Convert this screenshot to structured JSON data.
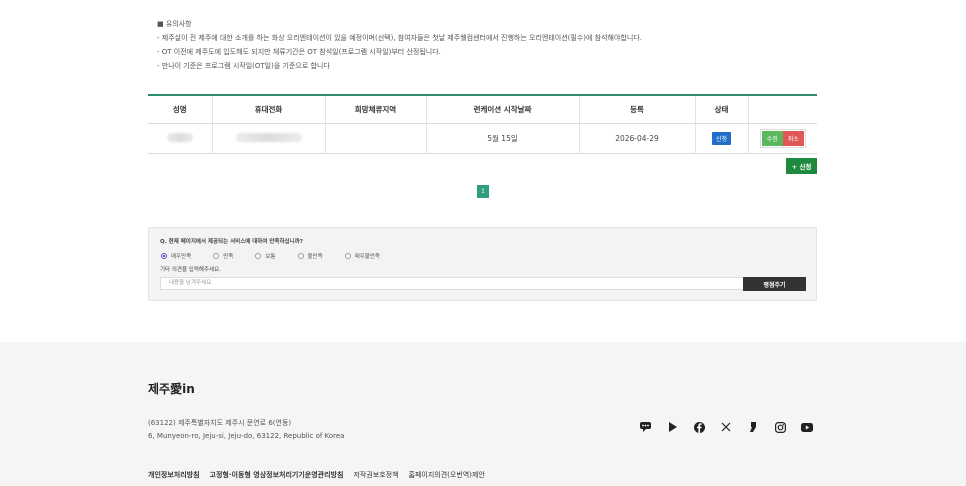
{
  "notice": {
    "title": "■ 유의사항",
    "lines": [
      "- 제주살이 전 제주에 대한 소개를 하는 화상 오리엔테이션이 있을 예정이며(선택), 참여자들은 첫날 제주웰컴센터에서 진행하는 오리엔테이션(필수)에 참석해야합니다.",
      "- OT 이전에 제주도에 입도해도 되지만 체류기간은 OT 참석일(프로그램 시작일)부터 산정됩니다.",
      "- 만나이 기준은 프로그램 시작일(OT일)을 기준으로 합니다"
    ]
  },
  "table": {
    "headers": [
      "성명",
      "휴대전화",
      "희망체류지역",
      "런케이션 시작날짜",
      "등록",
      "상태",
      ""
    ],
    "row": {
      "name": "",
      "phone": "",
      "region": "",
      "start_date": "5월 15일",
      "registered": "2026-04-29",
      "status": "신청",
      "edit_label": "수정",
      "cancel_label": "취소"
    }
  },
  "apply_button": "+ 신청",
  "pagination": {
    "current": "1"
  },
  "survey": {
    "question": "Q. 현재 페이지에서 제공되는 서비스에 대하여 만족하십니까?",
    "options": [
      "매우만족",
      "만족",
      "보통",
      "불만족",
      "매우불만족"
    ],
    "selected_index": 0,
    "other_label": "기타 의견을 입력해주세요.",
    "input_placeholder": "내용을 남겨주세요.",
    "submit_label": "평점주기"
  },
  "footer": {
    "logo": "제주愛in",
    "address_ko": "(63122) 제주특별자치도 제주시 문연로 6(연동)",
    "address_en": "6, Munyeon-ro, Jeju-si, Jeju-do, 63122, Republic of Korea",
    "links": [
      "개인정보처리방침",
      "고정형·이동형 영상정보처리기기운영관리방침",
      "저작권보호정책",
      "홈페이지의견(오번역)제안"
    ],
    "social": [
      "chat-icon",
      "play-icon",
      "facebook-icon",
      "x-icon",
      "blog-icon",
      "instagram-icon",
      "youtube-icon"
    ]
  },
  "colors": {
    "accent_green": "#2e8b6e",
    "status_blue": "#1f6fc8",
    "apply_green": "#1f8a3e"
  }
}
